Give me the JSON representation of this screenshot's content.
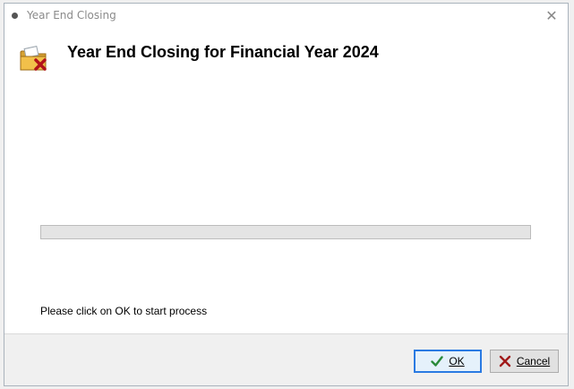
{
  "window": {
    "title": "Year End Closing"
  },
  "header": {
    "title": "Year End Closing for Financial Year 2024",
    "icon": "folder-close-icon"
  },
  "progress": {
    "value_percent": 0,
    "fill_color": "#2fa84f"
  },
  "message": "Please click on OK to start process",
  "buttons": {
    "ok_label": "OK",
    "cancel_label": "Cancel"
  },
  "colors": {
    "ok_border": "#2a7ae2",
    "check_color": "#2a8a3a",
    "cancel_x_color": "#a01818"
  }
}
